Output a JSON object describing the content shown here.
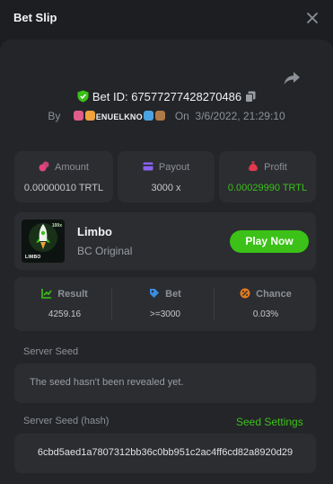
{
  "header": {
    "title": "Bet Slip"
  },
  "bet": {
    "id_label": "Bet ID: 67577277428270486",
    "by_label": "By",
    "user": "ENUELKNO",
    "on_label": "On",
    "datetime": "3/6/2022, 21:29:10"
  },
  "stats": {
    "amount": {
      "label": "Amount",
      "value": "0.00000010 TRTL",
      "color": "#e0457b"
    },
    "payout": {
      "label": "Payout",
      "value": "3000 x",
      "color": "#8a63f0"
    },
    "profit": {
      "label": "Profit",
      "value": "0.00029990 TRTL",
      "color": "#e2394f",
      "value_color": "#3bc117"
    }
  },
  "game": {
    "name": "Limbo",
    "subtitle": "BC Original",
    "play_label": "Play Now",
    "thumb_text": "LIMBO",
    "thumb_badge": "100x"
  },
  "result": {
    "result": {
      "label": "Result",
      "value": "4259.16"
    },
    "bet": {
      "label": "Bet",
      "value": ">=3000"
    },
    "chance": {
      "label": "Chance",
      "value": "0.03%"
    }
  },
  "server_seed": {
    "label": "Server Seed",
    "value": "The seed hasn't been revealed yet."
  },
  "server_seed_hash": {
    "label": "Server Seed (hash)",
    "link": "Seed Settings",
    "value": "6cbd5aed1a7807312bb36c0bb951c2ac4ff6cd82a8920d29"
  },
  "colors": {
    "accent": "#3bc117",
    "background": "#1a1c20",
    "card": "#2b2d31"
  }
}
